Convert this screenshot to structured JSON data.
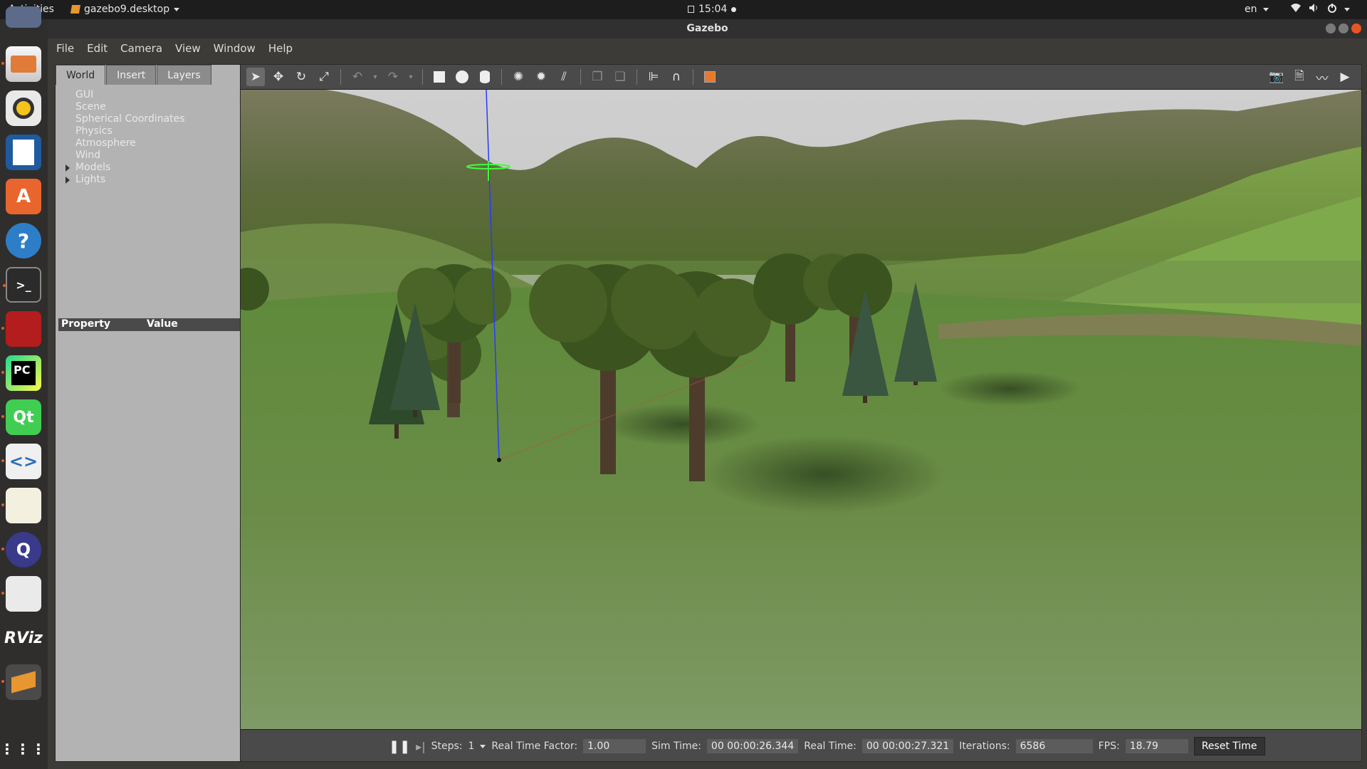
{
  "topbar": {
    "activities": "Activities",
    "app_name": "gazebo9.desktop",
    "time": "15:04",
    "lang": "en"
  },
  "window": {
    "title": "Gazebo"
  },
  "menu": [
    "File",
    "Edit",
    "Camera",
    "View",
    "Window",
    "Help"
  ],
  "left_panel": {
    "tabs": [
      "World",
      "Insert",
      "Layers"
    ],
    "active_tab": "World",
    "tree": [
      {
        "label": "GUI",
        "expandable": false
      },
      {
        "label": "Scene",
        "expandable": false
      },
      {
        "label": "Spherical Coordinates",
        "expandable": false
      },
      {
        "label": "Physics",
        "expandable": false
      },
      {
        "label": "Atmosphere",
        "expandable": false
      },
      {
        "label": "Wind",
        "expandable": false
      },
      {
        "label": "Models",
        "expandable": true
      },
      {
        "label": "Lights",
        "expandable": true
      }
    ],
    "property_header": {
      "property": "Property",
      "value": "Value"
    }
  },
  "toolbar": {
    "icons": [
      "select-mode-icon",
      "translate-mode-icon",
      "rotate-mode-icon",
      "scale-mode-icon",
      "undo-icon",
      "undo-history-icon",
      "redo-icon",
      "redo-history-icon",
      "box-shape-icon",
      "sphere-shape-icon",
      "cylinder-shape-icon",
      "point-light-icon",
      "spot-light-icon",
      "directional-light-icon",
      "copy-icon",
      "paste-icon",
      "align-icon",
      "snap-icon",
      "view-angle-icon"
    ],
    "right_icons": [
      "screenshot-icon",
      "log-data-icon",
      "plot-icon",
      "video-record-icon"
    ]
  },
  "statusbar": {
    "steps_label": "Steps:",
    "steps_value": "1",
    "rtf_label": "Real Time Factor:",
    "rtf_value": "1.00",
    "sim_time_label": "Sim Time:",
    "sim_time_value": "00 00:00:26.344",
    "real_time_label": "Real Time:",
    "real_time_value": "00 00:00:27.321",
    "iterations_label": "Iterations:",
    "iterations_value": "6586",
    "fps_label": "FPS:",
    "fps_value": "18.79",
    "reset_label": "Reset Time"
  },
  "dock": [
    "thunderbird-icon",
    "files-icon",
    "rhythmbox-icon",
    "writer-icon",
    "software-center-icon",
    "help-icon",
    "terminal-icon",
    "screen-recorder-icon",
    "pycharm-icon",
    "qt-creator-icon",
    "code-editor-icon",
    "text-editor-icon",
    "qgroundcontrol-icon",
    "gedit-icon",
    "rviz-icon",
    "gazebo-icon",
    "show-applications-icon"
  ],
  "colors": {
    "accent": "#e95420",
    "panel": "#b3b3b3",
    "toolbar": "#4a4a4a",
    "topbar": "#1d1d1d"
  }
}
